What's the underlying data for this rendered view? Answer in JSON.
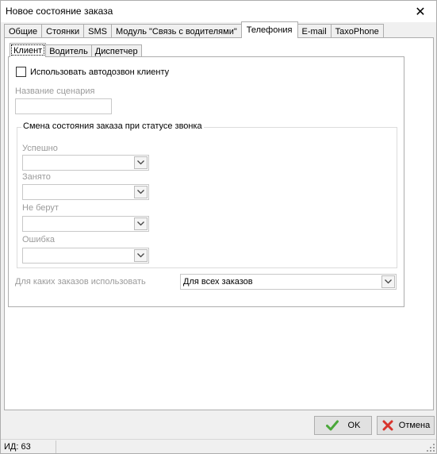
{
  "window": {
    "title": "Новое состояние заказа",
    "close_glyph": "✕"
  },
  "outer_tabs": [
    {
      "label": "Общие",
      "active": false
    },
    {
      "label": "Стоянки",
      "active": false
    },
    {
      "label": "SMS",
      "active": false
    },
    {
      "label": "Модуль \"Связь с водителями\"",
      "active": false
    },
    {
      "label": "Телефония",
      "active": true
    },
    {
      "label": "E-mail",
      "active": false
    },
    {
      "label": "TaxoPhone",
      "active": false
    }
  ],
  "inner_tabs": [
    {
      "label": "Клиент",
      "active": true
    },
    {
      "label": "Водитель",
      "active": false
    },
    {
      "label": "Диспетчер",
      "active": false
    }
  ],
  "client": {
    "autodial_label": "Использовать автодозвон клиенту",
    "autodial_checked": false,
    "scenario_label": "Название сценария",
    "scenario_value": "",
    "group_title": "Смена состояния заказа при статусе звонка",
    "status_success_label": "Успешно",
    "status_success_value": "",
    "status_busy_label": "Занято",
    "status_busy_value": "",
    "status_noanswer_label": "Не берут",
    "status_noanswer_value": "",
    "status_error_label": "Ошибка",
    "status_error_value": "",
    "orders_label": "Для каких заказов использовать",
    "orders_value": "Для всех заказов"
  },
  "buttons": {
    "ok_label": "OK",
    "cancel_label": "Отмена"
  },
  "status": {
    "id_text": "ИД: 63"
  },
  "colors": {
    "ok_icon": "#4aa83a",
    "cancel_icon": "#d8342c",
    "disabled_text": "#9b9b9b"
  }
}
